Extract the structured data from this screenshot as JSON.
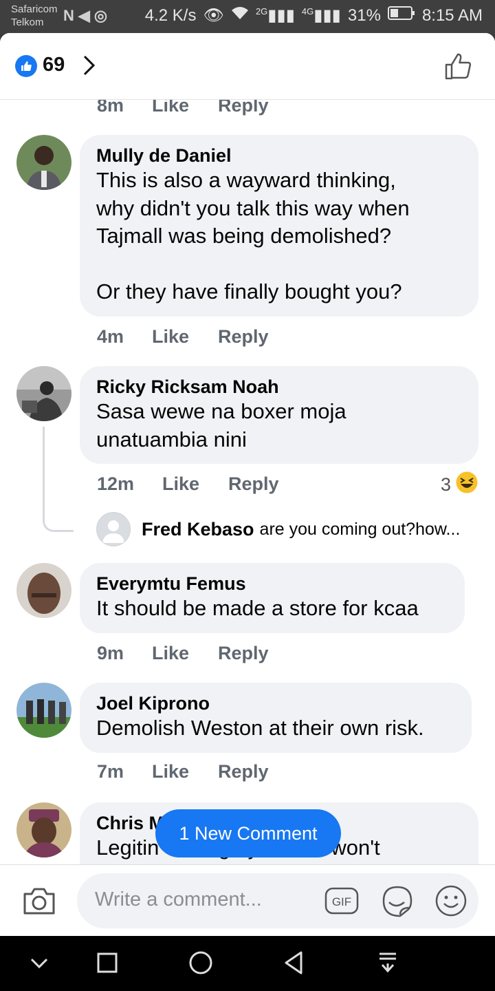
{
  "status_bar": {
    "carrier1": "Safaricom",
    "carrier2": "Telkom",
    "speed": "4.2 K/s",
    "net1": "2G",
    "net2": "4G",
    "battery": "31%",
    "time": "8:15 AM"
  },
  "header": {
    "reaction_count": "69"
  },
  "comments": [
    {
      "time": "8m",
      "like": "Like",
      "reply": "Reply"
    },
    {
      "name": "Mully de Daniel",
      "text": "This is also a wayward thinking,\nwhy didn't you talk this way when\nTajmall was being demolished?\n\nOr they have finally bought you?",
      "time": "4m",
      "like": "Like",
      "reply": "Reply"
    },
    {
      "name": "Ricky Ricksam Noah",
      "text": "Sasa wewe na boxer moja\nunatuambia nini",
      "time": "12m",
      "like": "Like",
      "reply": "Reply",
      "reaction_count": "3",
      "reply_preview": {
        "name": "Fred Kebaso",
        "text": "are you coming out?how..."
      }
    },
    {
      "name": "Everymtu Femus",
      "text": "It should be made a store for kcaa",
      "time": "9m",
      "like": "Like",
      "reply": "Reply"
    },
    {
      "name": "Joel Kiprono",
      "text": "Demolish Weston at their own risk.",
      "time": "7m",
      "like": "Like",
      "reply": "Reply"
    },
    {
      "name": "Chris M",
      "text": "Legitin          g   y,,, can't won't"
    }
  ],
  "new_comment_pill": "1 New Comment",
  "composer": {
    "placeholder": "Write a comment..."
  },
  "colors": {
    "accent": "#1877f2",
    "bubble": "#f0f2f5",
    "meta_text": "#606770"
  },
  "icons": [
    "like-badge-icon",
    "chevron-right-icon",
    "thumbs-up-outline-icon",
    "camera-icon",
    "gif-icon",
    "sticker-icon",
    "emoji-icon",
    "haha-reaction-icon",
    "nav-back-icon",
    "nav-home-icon",
    "nav-recents-icon",
    "nav-hide-icon",
    "nav-notification-icon"
  ]
}
